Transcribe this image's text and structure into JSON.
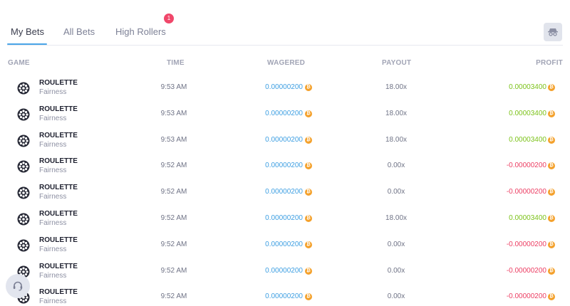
{
  "tabs": [
    {
      "label": "My Bets",
      "active": true
    },
    {
      "label": "All Bets",
      "active": false
    },
    {
      "label": "High Rollers",
      "active": false
    }
  ],
  "notification_count": "1",
  "hide_button_icon": "incognito-icon",
  "columns": {
    "game": "GAME",
    "time": "TIME",
    "wagered": "WAGERED",
    "payout": "PAYOUT",
    "profit": "PROFIT"
  },
  "currency_icon": "bitcoin-icon",
  "currency_glyph": "₿",
  "colors": {
    "accent": "#4aa5e8",
    "profit_positive": "#7cc21a",
    "profit_negative": "#ec3d62",
    "badge": "#f0476a",
    "coin": "#f4a12c"
  },
  "bets": [
    {
      "game": "ROULETTE",
      "sub": "Fairness",
      "time": "9:53 AM",
      "wagered": "0.00000200",
      "payout": "18.00x",
      "profit": "0.00003400",
      "positive": true
    },
    {
      "game": "ROULETTE",
      "sub": "Fairness",
      "time": "9:53 AM",
      "wagered": "0.00000200",
      "payout": "18.00x",
      "profit": "0.00003400",
      "positive": true
    },
    {
      "game": "ROULETTE",
      "sub": "Fairness",
      "time": "9:53 AM",
      "wagered": "0.00000200",
      "payout": "18.00x",
      "profit": "0.00003400",
      "positive": true
    },
    {
      "game": "ROULETTE",
      "sub": "Fairness",
      "time": "9:52 AM",
      "wagered": "0.00000200",
      "payout": "0.00x",
      "profit": "-0.00000200",
      "positive": false
    },
    {
      "game": "ROULETTE",
      "sub": "Fairness",
      "time": "9:52 AM",
      "wagered": "0.00000200",
      "payout": "0.00x",
      "profit": "-0.00000200",
      "positive": false
    },
    {
      "game": "ROULETTE",
      "sub": "Fairness",
      "time": "9:52 AM",
      "wagered": "0.00000200",
      "payout": "18.00x",
      "profit": "0.00003400",
      "positive": true
    },
    {
      "game": "ROULETTE",
      "sub": "Fairness",
      "time": "9:52 AM",
      "wagered": "0.00000200",
      "payout": "0.00x",
      "profit": "-0.00000200",
      "positive": false
    },
    {
      "game": "ROULETTE",
      "sub": "Fairness",
      "time": "9:52 AM",
      "wagered": "0.00000200",
      "payout": "0.00x",
      "profit": "-0.00000200",
      "positive": false
    },
    {
      "game": "ROULETTE",
      "sub": "Fairness",
      "time": "9:52 AM",
      "wagered": "0.00000200",
      "payout": "0.00x",
      "profit": "-0.00000200",
      "positive": false
    }
  ],
  "support_icon": "headset-icon"
}
